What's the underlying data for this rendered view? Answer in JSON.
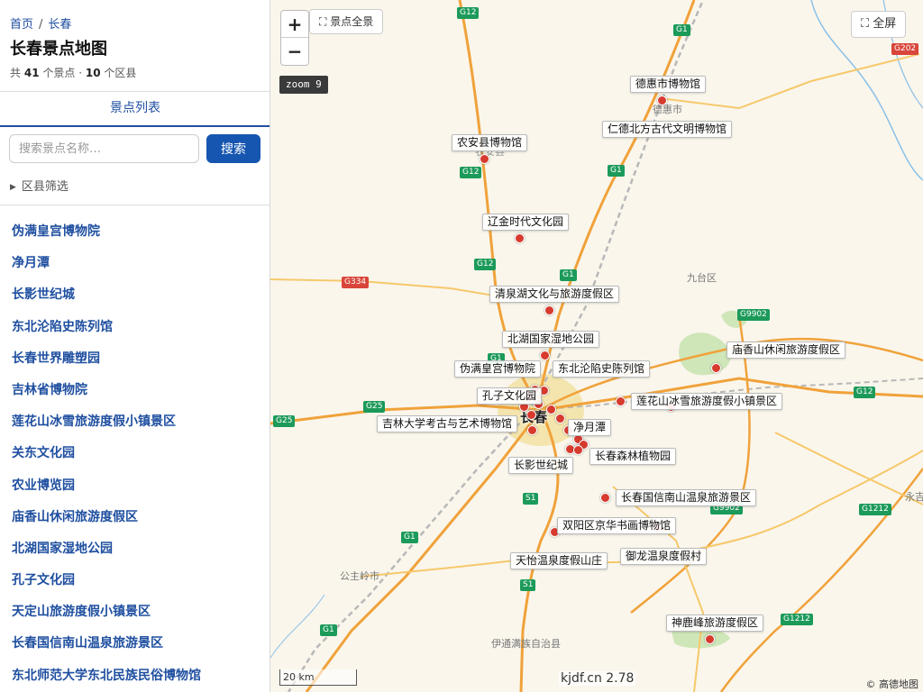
{
  "breadcrumb": {
    "home": "首页",
    "separator": "/",
    "current": "长春"
  },
  "page_title": "长春景点地图",
  "summary": {
    "prefix": "共",
    "poi_count": "41",
    "poi_unit": "个景点 ·",
    "district_count": "10",
    "district_unit": "个区县"
  },
  "tab": {
    "label": "景点列表"
  },
  "search": {
    "placeholder": "搜索景点名称…",
    "button": "搜索"
  },
  "filter": {
    "label": "区县筛选"
  },
  "poi_list": [
    "伪满皇宫博物院",
    "净月潭",
    "长影世纪城",
    "东北沦陷史陈列馆",
    "长春世界雕塑园",
    "吉林省博物院",
    "莲花山冰雪旅游度假小镇景区",
    "关东文化园",
    "农业博览园",
    "庙香山休闲旅游度假区",
    "北湖国家湿地公园",
    "孔子文化园",
    "天定山旅游度假小镇景区",
    "长春国信南山温泉旅游景区",
    "东北师范大学东北民族民俗博物馆"
  ],
  "map": {
    "overview_button": "⛶ 景点全景",
    "fullscreen_button": "⛶ 全屏",
    "zoom_in": "+",
    "zoom_out": "−",
    "zoom_badge": "zoom 9",
    "scale": "20 km",
    "watermark": "kjdf.cn 2.78",
    "copyright": "© 高德地图",
    "city_label": "长春",
    "labels": [
      "德惠市博物馆",
      "仁德北方古代文明博物馆",
      "农安县博物馆",
      "辽金时代文化园",
      "清泉湖文化与旅游度假区",
      "北湖国家湿地公园",
      "庙香山休闲旅游度假区",
      "伪满皇宫博物院",
      "东北沦陷史陈列馆",
      "孔子文化园",
      "莲花山冰雪旅游度假小镇景区",
      "吉林大学考古与艺术博物馆",
      "净月潭",
      "长春森林植物园",
      "长影世纪城",
      "长春国信南山温泉旅游景区",
      "双阳区京华书画博物馆",
      "御龙温泉度假村",
      "天怡温泉度假山庄",
      "神鹿峰旅游度假区"
    ],
    "base_labels": [
      "德惠市",
      "九台区",
      "公主岭市",
      "伊通满族自治县",
      "永吉",
      "农安县"
    ],
    "road_shields": [
      "G12",
      "G1",
      "G202",
      "G12",
      "G1",
      "G12",
      "G1",
      "G334",
      "G9902",
      "G1",
      "G12",
      "G25",
      "G25",
      "S1",
      "G1",
      "G9902",
      "G1212",
      "S1",
      "G1",
      "G1212"
    ],
    "colors": {
      "marker": "#d83a2e",
      "expressway": "#f0a23a",
      "highway": "#f6c86a",
      "water": "#8cc0e8",
      "urban": "#f3e3a8"
    }
  }
}
